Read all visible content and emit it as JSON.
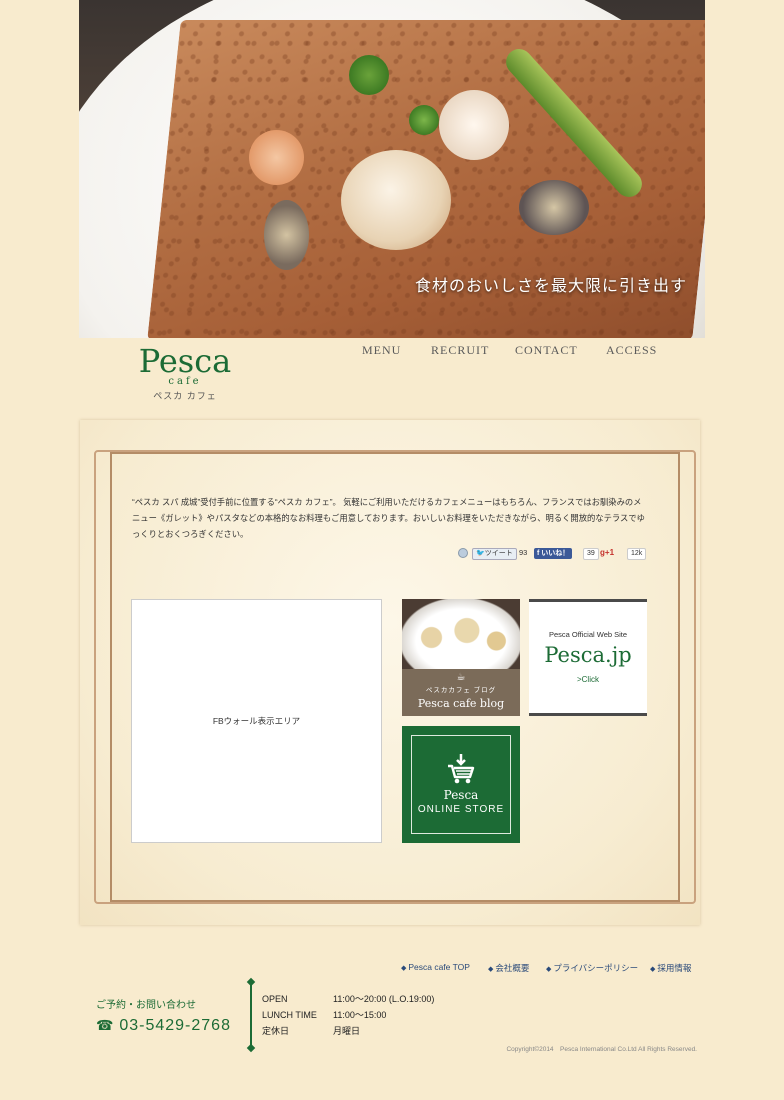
{
  "hero": {
    "caption": "食材のおいしさを最大限に引き出す"
  },
  "logo": {
    "word": "Pesca",
    "sub": "cafe",
    "kana": "ペスカ カフェ"
  },
  "nav": {
    "items": [
      {
        "label": "MENU"
      },
      {
        "label": "RECRUIT"
      },
      {
        "label": "CONTACT"
      },
      {
        "label": "ACCESS"
      }
    ]
  },
  "intro": {
    "text": "“ペスカ スパ 成城”受付手前に位置する“ペスカ カフェ”。 気軽にご利用いただけるカフェメニューはもちろん、フランスではお馴染みのメニュー《ガレット》やパスタなどの本格的なお料理もご用意しております。おいしいお料理をいただきながら、明るく開放的なテラスでゆっくりとおくつろぎください。"
  },
  "social": {
    "tweet_label": "ツイート",
    "tweet_count": "93",
    "like_label": "いいね！",
    "like_count": "39",
    "gplus_label": "+1",
    "gplus_count": "12k"
  },
  "fb_area": {
    "label": "FBウォール表示エリア"
  },
  "banners": {
    "blog": {
      "small": "ペスカカフェ ブログ",
      "title": "Pesca cafe blog"
    },
    "official": {
      "small": "Pesca Official Web Site",
      "title": "Pesca.jp",
      "click": ">Click"
    },
    "store": {
      "line1": "Pesca",
      "line2": "ONLINE STORE"
    }
  },
  "footer": {
    "links": [
      {
        "label": "Pesca cafe TOP"
      },
      {
        "label": "会社概要"
      },
      {
        "label": "プライバシーポリシー"
      },
      {
        "label": "採用情報"
      }
    ],
    "contact_label": "ご予約・お問い合わせ",
    "tel": "03-5429-2768",
    "hours": [
      {
        "k": "OPEN",
        "v": "11:00～20:00 (L.O.19:00)"
      },
      {
        "k": "LUNCH TIME",
        "v": "11:00～15:00"
      },
      {
        "k": "定休日",
        "v": "月曜日"
      }
    ],
    "copyright": "Copyright©2014　Pesca International Co.Ltd All Rights Reserved."
  },
  "colors": {
    "background": "#f8ebce",
    "brand_green": "#1c6b35",
    "frame": "#b48c66",
    "footer_link": "#2a4a7a"
  },
  "icons": [
    "phone-icon",
    "cart-icon",
    "coffee-cup-icon",
    "facebook-icon",
    "twitter-icon",
    "gplus-icon",
    "share-icon"
  ]
}
